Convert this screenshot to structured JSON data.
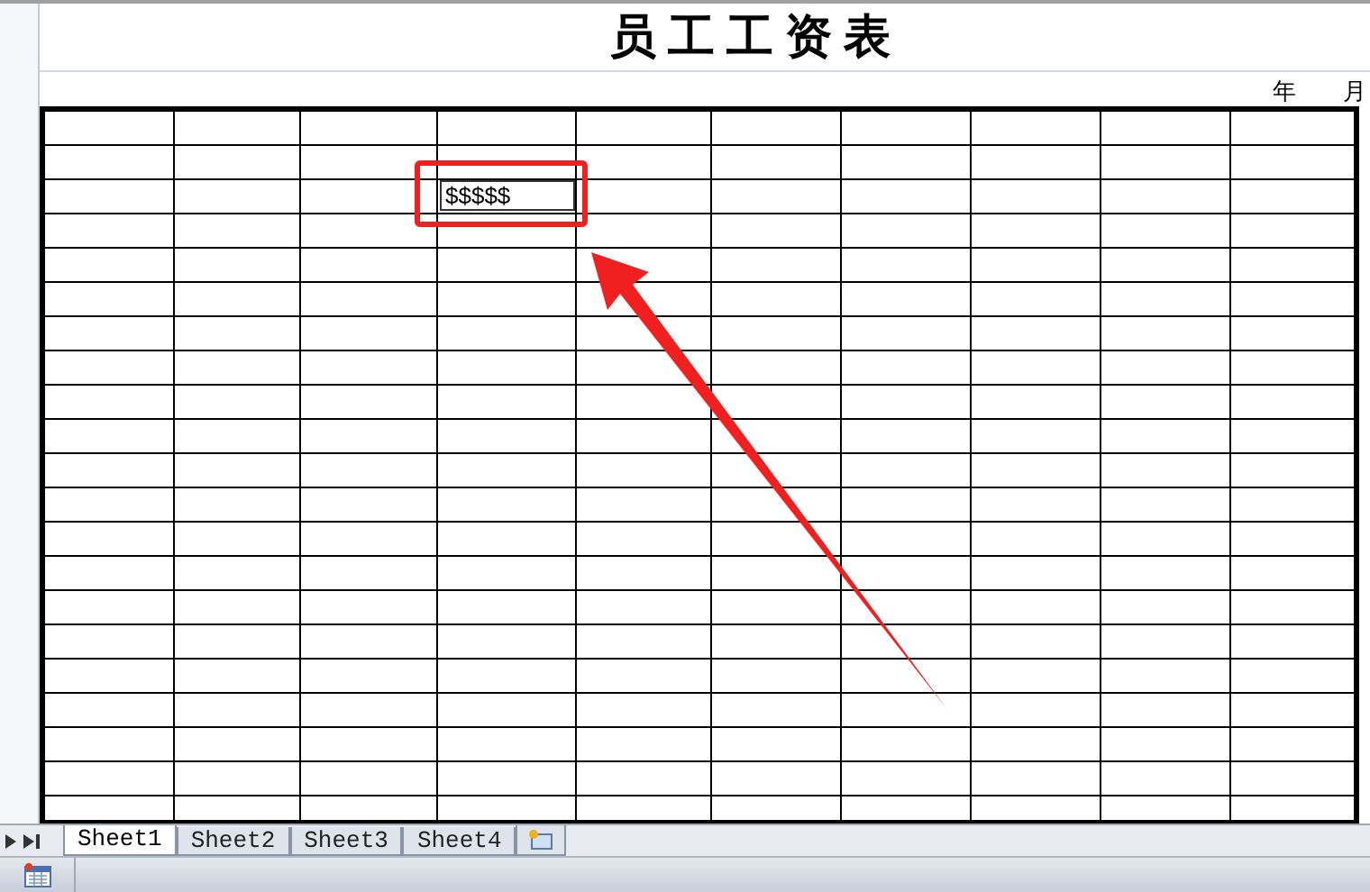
{
  "sheet_title": "员 工 工 资 表",
  "date_labels": [
    "年",
    "月"
  ],
  "table": {
    "active_cell": {
      "value": "$$$$$"
    }
  },
  "sheet_tabs": [
    {
      "label": "Sheet1",
      "selected": true
    },
    {
      "label": "Sheet2",
      "selected": false
    },
    {
      "label": "Sheet3",
      "selected": false
    },
    {
      "label": "Sheet4",
      "selected": false
    }
  ]
}
